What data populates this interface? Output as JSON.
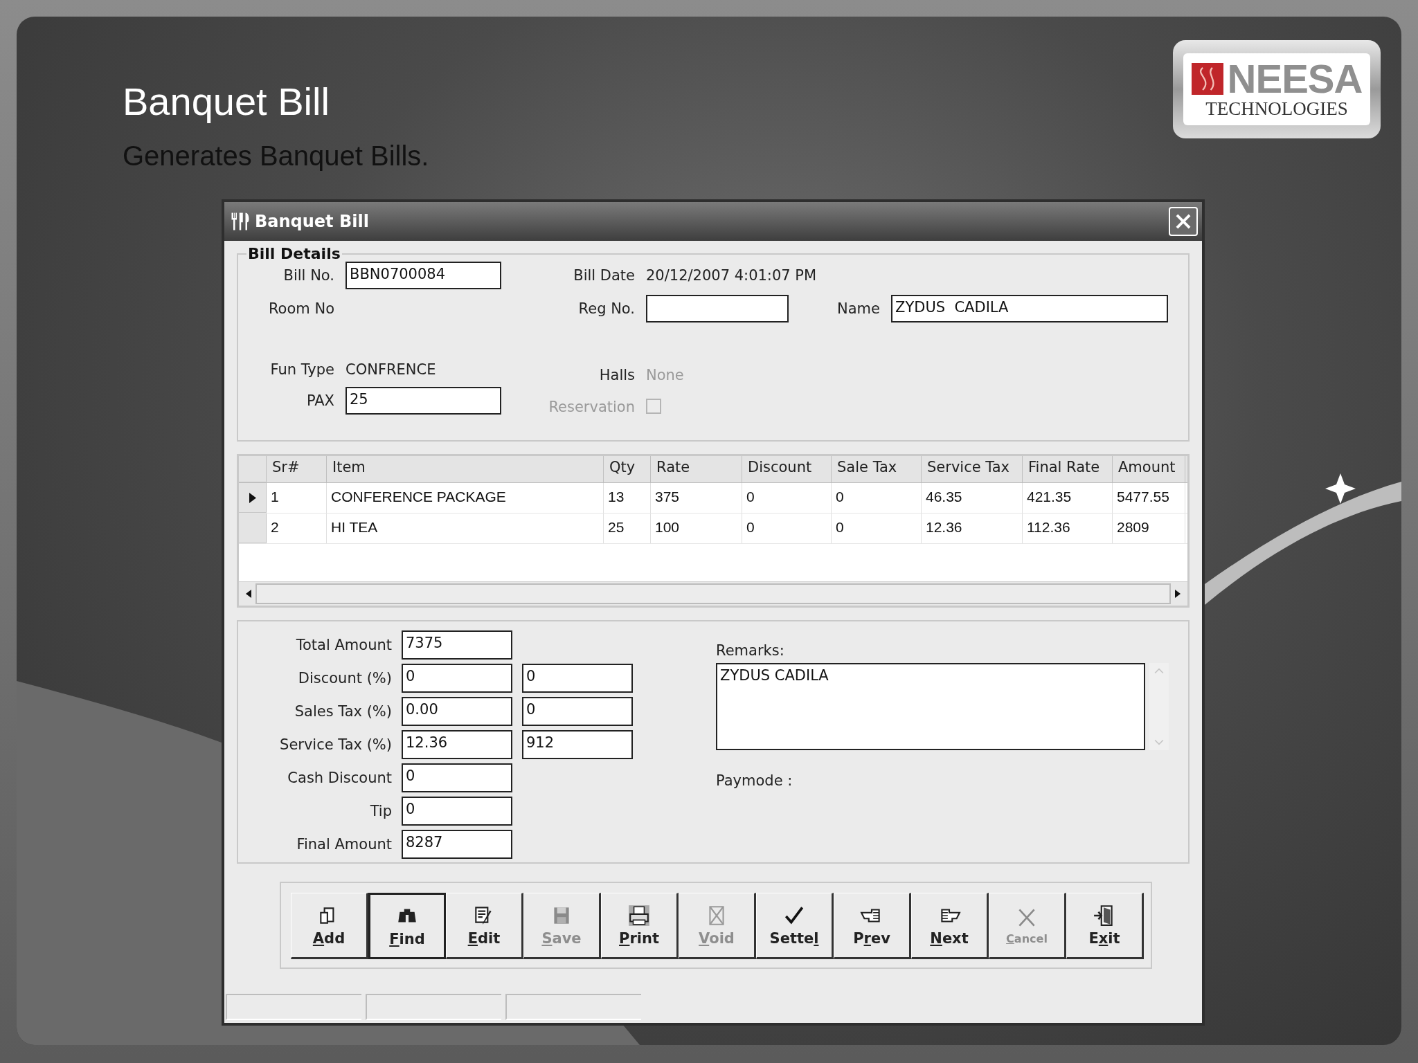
{
  "slide": {
    "title": "Banquet Bill",
    "subtitle": "Generates Banquet Bills.",
    "logo": {
      "name": "NEESA",
      "tagline": "TECHNOLOGIES"
    }
  },
  "window": {
    "title": "Banquet Bill"
  },
  "bill_details": {
    "legend": "Bill Details",
    "bill_no": {
      "label": "Bill No.",
      "value": "BBN0700084"
    },
    "bill_date": {
      "label": "Bill Date",
      "value": "20/12/2007 4:01:07 PM"
    },
    "room_no": {
      "label": "Room No"
    },
    "reg_no": {
      "label": "Reg No."
    },
    "name": {
      "label": "Name",
      "value": "ZYDUS  CADILA"
    },
    "fun_type": {
      "label": "Fun Type",
      "value": "CONFRENCE"
    },
    "halls": {
      "label": "Halls",
      "value": "None",
      "disabled": true
    },
    "pax": {
      "label": "PAX",
      "value": "25"
    },
    "reservation": {
      "label": "Reservation",
      "checked": false,
      "disabled": true
    }
  },
  "items_table": {
    "columns": [
      "Sr#",
      "Item",
      "Qty",
      "Rate",
      "Discount",
      "Sale Tax",
      "Service Tax",
      "Final Rate",
      "Amount"
    ],
    "rows": [
      {
        "current": true,
        "cells": [
          "1",
          "CONFERENCE PACKAGE",
          "13",
          "375",
          "0",
          "0",
          "46.35",
          "421.35",
          "5477.55"
        ]
      },
      {
        "current": false,
        "cells": [
          "2",
          "HI TEA",
          "25",
          "100",
          "0",
          "0",
          "12.36",
          "112.36",
          "2809"
        ]
      }
    ]
  },
  "totals": [
    {
      "label": "Total Amount",
      "value": "7375"
    },
    {
      "label": "Discount (%)",
      "value": "0",
      "amount": "0"
    },
    {
      "label": "Sales Tax (%)",
      "value": "0.00",
      "amount": "0"
    },
    {
      "label": "Service Tax (%)",
      "value": "12.36",
      "amount": "912"
    },
    {
      "label": "Cash Discount",
      "value": "0"
    },
    {
      "label": "Tip",
      "value": "0"
    },
    {
      "label": "Final Amount",
      "value": "8287"
    }
  ],
  "remarks": {
    "label": "Remarks:",
    "value": "ZYDUS CADILA"
  },
  "paymode": {
    "label": "Paymode :"
  },
  "toolbar": [
    {
      "kind": "add",
      "key": "A",
      "post": "dd",
      "disabled": false,
      "focused": false
    },
    {
      "kind": "find",
      "key": "F",
      "post": "ind",
      "disabled": false,
      "focused": true
    },
    {
      "kind": "edit",
      "key": "E",
      "post": "dit",
      "disabled": false,
      "focused": false
    },
    {
      "kind": "save",
      "key": "S",
      "post": "ave",
      "disabled": true,
      "focused": false
    },
    {
      "kind": "print",
      "key": "P",
      "post": "rint",
      "disabled": false,
      "focused": false
    },
    {
      "kind": "void",
      "key": "V",
      "post": "oid",
      "disabled": true,
      "focused": false
    },
    {
      "kind": "settle",
      "pre": "Sette",
      "key": "l",
      "disabled": false,
      "focused": false
    },
    {
      "kind": "prev",
      "pre": "P",
      "key": "r",
      "post": "ev",
      "disabled": false,
      "focused": false
    },
    {
      "kind": "next",
      "key": "N",
      "post": "ext",
      "disabled": false,
      "focused": false
    },
    {
      "kind": "cancel",
      "key": "C",
      "post": "ancel",
      "disabled": true,
      "focused": false
    },
    {
      "kind": "exit",
      "pre": "E",
      "key": "x",
      "post": "it",
      "disabled": false,
      "focused": false
    }
  ]
}
